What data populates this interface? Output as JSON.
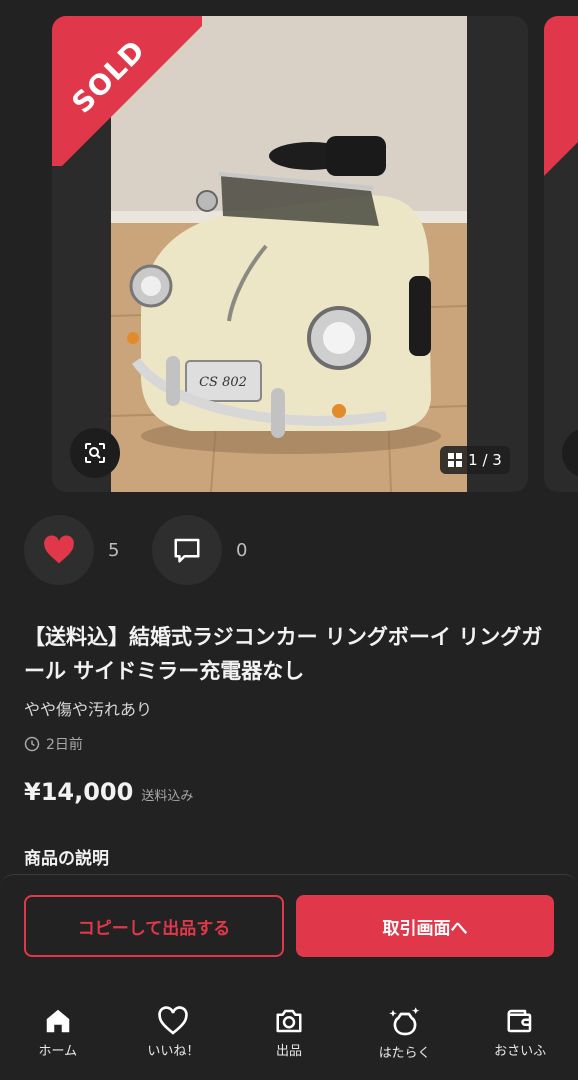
{
  "listing": {
    "status": "SOLD",
    "image_counter": "1 / 3",
    "image_plate": "CS 802",
    "likes": "5",
    "comments": "0",
    "title": "【送料込】結婚式ラジコンカー リングボーイ リングガール サイドミラー充電器なし",
    "condition": "やや傷や汚れあり",
    "posted": "2日前",
    "price": "¥14,000",
    "price_note": "送料込み",
    "description_heading": "商品の説明"
  },
  "actions": {
    "copy_label": "コピーして出品する",
    "trade_label": "取引画面へ"
  },
  "tabs": [
    {
      "label": "ホーム",
      "icon": "home-icon"
    },
    {
      "label": "いいね！",
      "icon": "heart-outline-icon"
    },
    {
      "label": "出品",
      "icon": "camera-icon"
    },
    {
      "label": "はたらく",
      "icon": "sparkle-bag-icon"
    },
    {
      "label": "おさいふ",
      "icon": "wallet-icon"
    }
  ],
  "colors": {
    "accent": "#e0384a",
    "background": "#222222"
  }
}
